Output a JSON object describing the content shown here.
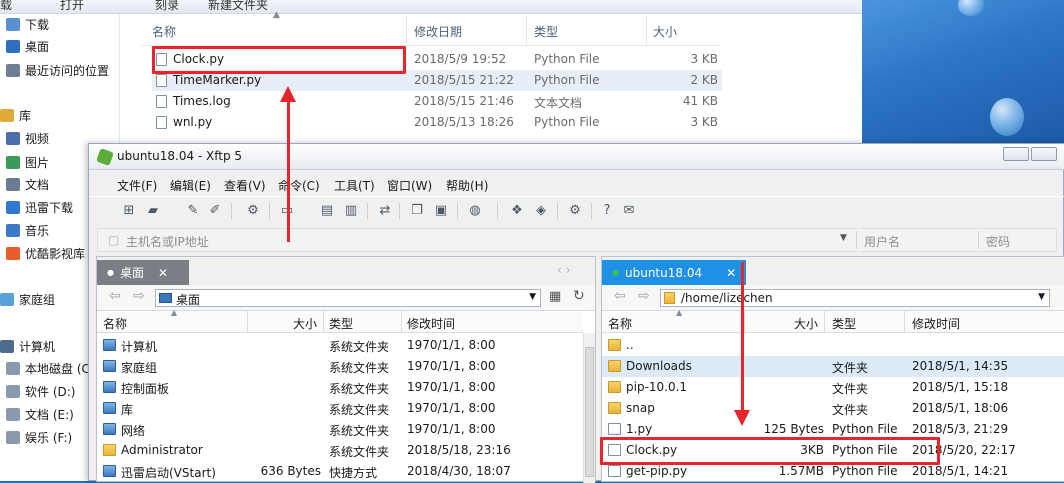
{
  "explorer": {
    "top_fragments": [
      "载",
      "打开",
      "刻录",
      "新建文件夹"
    ],
    "sidebar": [
      {
        "label": "下载",
        "icon": "download-folder-icon"
      },
      {
        "label": "桌面",
        "icon": "desktop-icon"
      },
      {
        "label": "最近访问的位置",
        "icon": "recent-places-icon"
      },
      {
        "label": "库",
        "icon": "library-icon"
      },
      {
        "label": "视频",
        "icon": "video-icon"
      },
      {
        "label": "图片",
        "icon": "picture-icon"
      },
      {
        "label": "文档",
        "icon": "document-icon"
      },
      {
        "label": "迅雷下载",
        "icon": "thunder-download-icon"
      },
      {
        "label": "音乐",
        "icon": "music-icon"
      },
      {
        "label": "优酷影视库",
        "icon": "youku-icon"
      },
      {
        "label": "家庭组",
        "icon": "homegroup-icon"
      },
      {
        "label": "计算机",
        "icon": "computer-icon"
      },
      {
        "label": "本地磁盘 (C",
        "icon": "disk-icon"
      },
      {
        "label": "软件 (D:)",
        "icon": "disk-icon"
      },
      {
        "label": "文档 (E:)",
        "icon": "disk-icon"
      },
      {
        "label": "娱乐 (F:)",
        "icon": "disk-icon"
      }
    ],
    "columns": {
      "name": "名称",
      "date": "修改日期",
      "type": "类型",
      "size": "大小"
    },
    "files": [
      {
        "name": "Clock.py",
        "date": "2018/5/9 19:52",
        "type": "Python File",
        "size": "3 KB"
      },
      {
        "name": "TimeMarker.py",
        "date": "2018/5/15 21:22",
        "type": "Python File",
        "size": "2 KB"
      },
      {
        "name": "Times.log",
        "date": "2018/5/15 21:46",
        "type": "文本文档",
        "size": "41 KB"
      },
      {
        "name": "wnl.py",
        "date": "2018/5/13 18:26",
        "type": "Python File",
        "size": "3 KB"
      }
    ]
  },
  "xftp": {
    "title": "ubuntu18.04   - Xftp 5",
    "menu": [
      "文件(F)",
      "编辑(E)",
      "查看(V)",
      "命令(C)",
      "工具(T)",
      "窗口(W)",
      "帮助(H)"
    ],
    "address": {
      "host_placeholder": "主机名或IP地址",
      "user_placeholder": "用户名",
      "password_placeholder": "密码"
    },
    "left_pane": {
      "tab": "桌面",
      "path": "桌面",
      "columns": {
        "name": "名称",
        "size": "大小",
        "type": "类型",
        "date": "修改时间"
      },
      "rows": [
        {
          "name": "计算机",
          "size": "",
          "type": "系统文件夹",
          "date": "1970/1/1, 8:00"
        },
        {
          "name": "家庭组",
          "size": "",
          "type": "系统文件夹",
          "date": "1970/1/1, 8:00"
        },
        {
          "name": "控制面板",
          "size": "",
          "type": "系统文件夹",
          "date": "1970/1/1, 8:00"
        },
        {
          "name": "库",
          "size": "",
          "type": "系统文件夹",
          "date": "1970/1/1, 8:00"
        },
        {
          "name": "网络",
          "size": "",
          "type": "系统文件夹",
          "date": "1970/1/1, 8:00"
        },
        {
          "name": "Administrator",
          "size": "",
          "type": "系统文件夹",
          "date": "2018/5/18, 23:16"
        },
        {
          "name": "迅雷启动(VStart)",
          "size": "636 Bytes",
          "type": "快捷方式",
          "date": "2018/4/30, 18:07"
        }
      ]
    },
    "right_pane": {
      "tab": "ubuntu18.04",
      "path": "/home/lizechen",
      "columns": {
        "name": "名称",
        "size": "大小",
        "type": "类型",
        "date": "修改时间"
      },
      "rows": [
        {
          "name": "..",
          "size": "",
          "type": "",
          "date": ""
        },
        {
          "name": "Downloads",
          "size": "",
          "type": "文件夹",
          "date": "2018/5/1, 14:35"
        },
        {
          "name": "pip-10.0.1",
          "size": "",
          "type": "文件夹",
          "date": "2018/5/1, 15:18"
        },
        {
          "name": "snap",
          "size": "",
          "type": "文件夹",
          "date": "2018/5/1, 18:06"
        },
        {
          "name": "1.py",
          "size": "125 Bytes",
          "type": "Python File",
          "date": "2018/5/3, 21:29"
        },
        {
          "name": "Clock.py",
          "size": "3KB",
          "type": "Python File",
          "date": "2018/5/20, 22:17"
        },
        {
          "name": "get-pip.py",
          "size": "1.57MB",
          "type": "Python File",
          "date": "2018/5/1, 14:21"
        }
      ]
    }
  },
  "colors": {
    "highlight": "#e8252b",
    "tab_active": "#1e90e6"
  }
}
